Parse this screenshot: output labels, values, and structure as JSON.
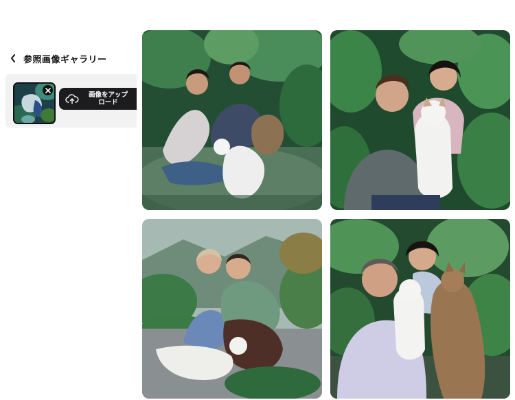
{
  "sidebar": {
    "back_icon": "chevron-left-icon",
    "title": "参照画像ギャラリー"
  },
  "upload": {
    "thumbnail_icon": "reference-thumbnail",
    "remove_icon": "close-icon",
    "button_icon": "cloud-upload-icon",
    "button_label": "画像をアップ\nロード"
  },
  "gallery": {
    "images": [
      {
        "id": 1,
        "alt": ""
      },
      {
        "id": 2,
        "alt": ""
      },
      {
        "id": 3,
        "alt": ""
      },
      {
        "id": 4,
        "alt": ""
      }
    ]
  },
  "colors": {
    "panel_bg": "#f2f2f3",
    "button_bg": "#1c1c1e",
    "leaf_green": "#2f6b3b"
  }
}
